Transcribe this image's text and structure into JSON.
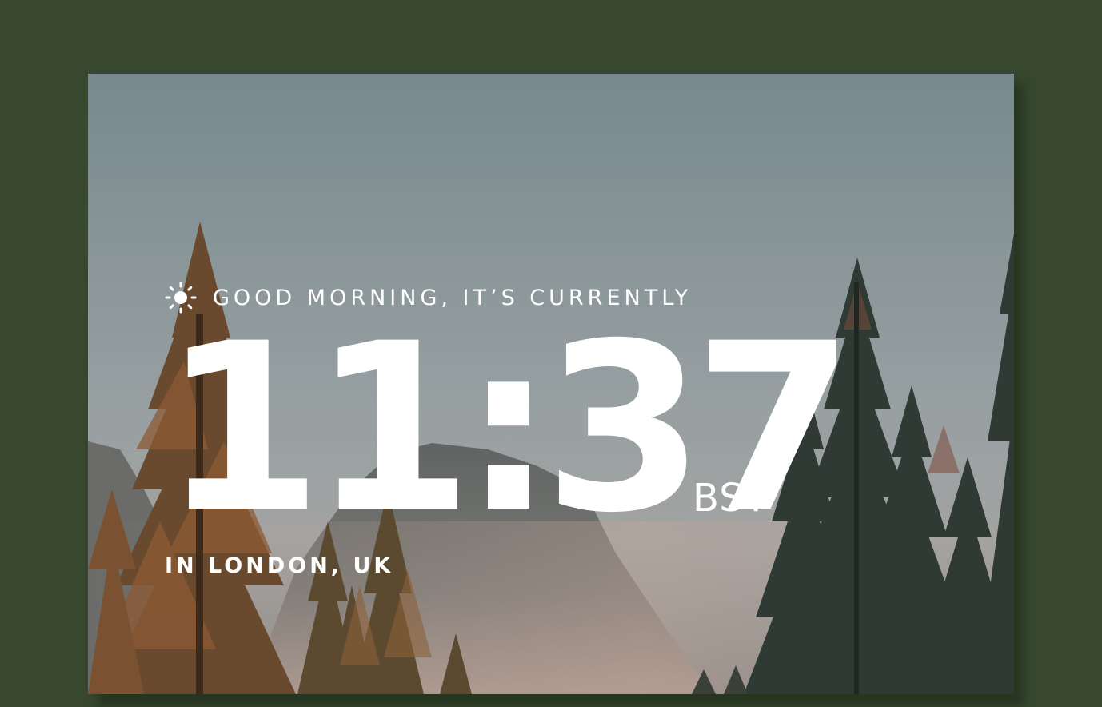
{
  "greeting": {
    "icon": "sun-icon",
    "text": "GOOD MORNING, IT’S CURRENTLY"
  },
  "clock": {
    "time": "11:37",
    "timezone": "BST"
  },
  "location": {
    "text": "IN LONDON, UK"
  },
  "colors": {
    "page_background": "#37482f",
    "text": "#ffffff"
  }
}
